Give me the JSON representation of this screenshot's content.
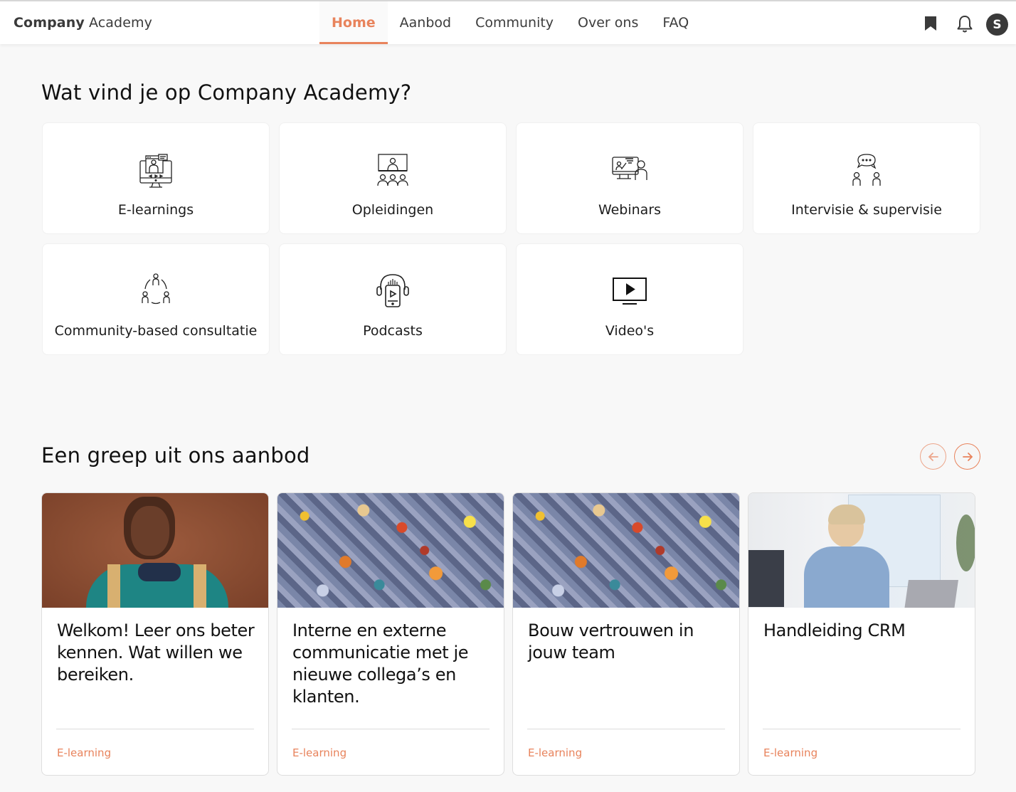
{
  "header": {
    "brand_bold": "Company",
    "brand_light": "Academy",
    "nav": [
      {
        "label": "Home",
        "active": true
      },
      {
        "label": "Aanbod",
        "active": false
      },
      {
        "label": "Community",
        "active": false
      },
      {
        "label": "Over ons",
        "active": false
      },
      {
        "label": "FAQ",
        "active": false
      }
    ],
    "icons": [
      "bookmark-icon",
      "bell-icon"
    ],
    "avatar_initial": "S"
  },
  "categories_section": {
    "title": "Wat vind je op Company Academy?",
    "items": [
      {
        "label": "E-learnings",
        "icon": "elearning-monitor-icon"
      },
      {
        "label": "Opleidingen",
        "icon": "classroom-icon"
      },
      {
        "label": "Webinars",
        "icon": "webinar-presenter-icon"
      },
      {
        "label": "Intervisie & supervisie",
        "icon": "conversation-icon"
      },
      {
        "label": "Community-based consultatie",
        "icon": "community-circle-icon"
      },
      {
        "label": "Podcasts",
        "icon": "podcast-headphones-icon"
      },
      {
        "label": "Video's",
        "icon": "video-play-icon"
      }
    ]
  },
  "offer_section": {
    "title": "Een greep uit ons aanbod",
    "prev_label": "previous",
    "next_label": "next",
    "courses": [
      {
        "title": "Welkom! Leer ons beter kennen. Wat willen we bereiken.",
        "type": "E-learning",
        "image": "smiling man with headphones"
      },
      {
        "title": "Interne en externe communicatie met je nieuwe collega’s en klanten.",
        "type": "E-learning",
        "image": "puzzle pieces"
      },
      {
        "title": "Bouw vertrouwen in jouw team",
        "type": "E-learning",
        "image": "puzzle pieces"
      },
      {
        "title": "Handleiding CRM",
        "type": "E-learning",
        "image": "woman at laptop"
      }
    ]
  },
  "colors": {
    "accent": "#e8835c",
    "background": "#f8f8f8",
    "avatar": "#3a3a3a"
  }
}
